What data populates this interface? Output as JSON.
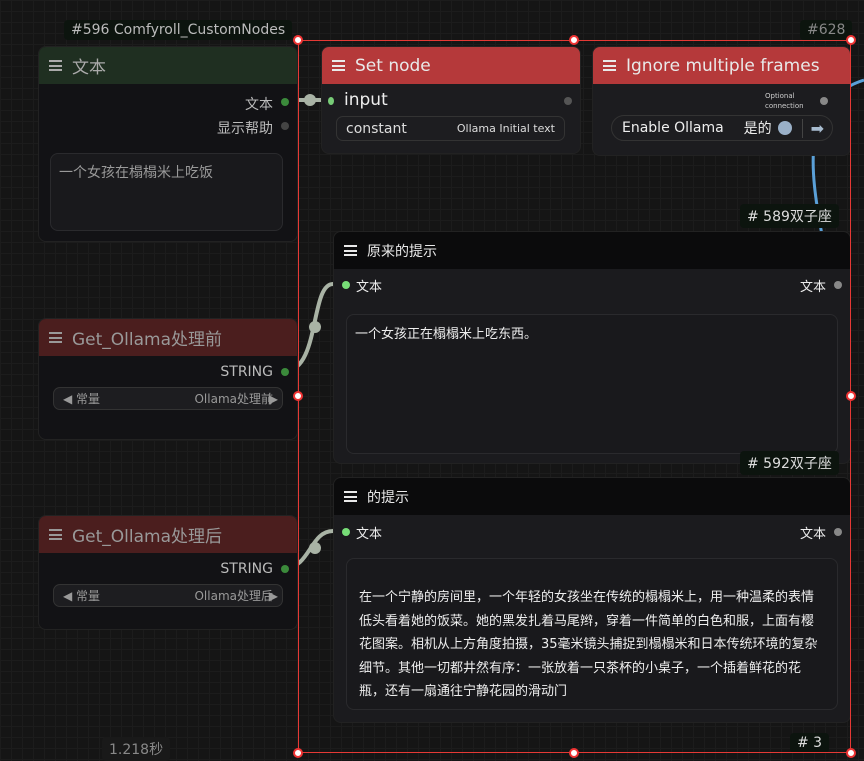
{
  "nodes": {
    "text_node": {
      "badge": "#596 Comfyroll_CustomNodes",
      "title": "文本",
      "outputs": [
        "文本",
        "显示帮助"
      ],
      "text": "一个女孩在榻榻米上吃饭"
    },
    "set_node": {
      "title": "Set node",
      "input": "input",
      "widget_label": "constant",
      "widget_value": "Ollama Initial text"
    },
    "ignore_node": {
      "badge": "#628",
      "title": "Ignore multiple frames",
      "optional": "Optional connection",
      "toggle_label": "Enable Ollama",
      "toggle_value": "是的"
    },
    "get_before": {
      "title": "Get_Ollama处理前",
      "output": "STRING",
      "widget_label": "常量",
      "widget_value": "Ollama处理前"
    },
    "get_after": {
      "title": "Get_Ollama处理后",
      "output": "STRING",
      "widget_label": "常量",
      "widget_value": "Ollama处理后"
    },
    "original_prompt": {
      "badge": "# 589双子座",
      "title": "原来的提示",
      "input": "文本",
      "output": "文本",
      "text": "一个女孩正在榻榻米上吃东西。"
    },
    "prompt": {
      "badge": "# 592双子座",
      "title": "的提示",
      "input": "文本",
      "output": "文本",
      "text": "在一个宁静的房间里，一个年轻的女孩坐在传统的榻榻米上，用一种温柔的表情低头看着她的饭菜。她的黑发扎着马尾辫，穿着一件简单的白色和服，上面有樱花图案。相机从上方角度拍摄，35毫米镜头捕捉到榻榻米和日本传统环境的复杂细节。其他一切都井然有序：一张放着一只茶杯的小桌子，一个插着鲜花的花瓶，还有一扇通往宁静花园的滑动门"
    },
    "group_badge": "# 3"
  },
  "status": {
    "time": "1.218秒"
  },
  "colors": {
    "green_header": "#1f2f21",
    "red_header": "#b5393a",
    "dark_red_header": "#4b1e1e",
    "selection": "#e53935",
    "link_blue": "#5aa0d8"
  }
}
